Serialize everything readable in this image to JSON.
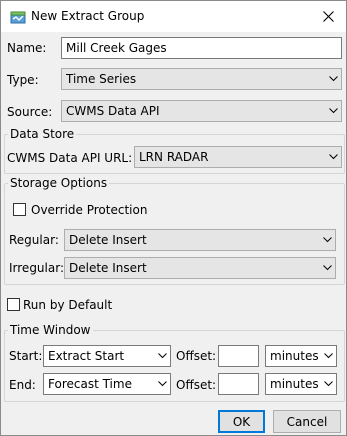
{
  "window": {
    "title": "New Extract Group",
    "close_icon": "close-icon",
    "app_icon": "extract-group-icon"
  },
  "name": {
    "label": "Name:",
    "value": "Mill Creek Gages"
  },
  "type": {
    "label": "Type:",
    "value": "Time Series"
  },
  "source": {
    "label": "Source:",
    "value": "CWMS Data API"
  },
  "data_store": {
    "title": "Data Store",
    "url_label": "CWMS Data API URL:",
    "url_value": "LRN RADAR"
  },
  "storage": {
    "title": "Storage Options",
    "override_label": "Override Protection",
    "override_checked": false,
    "regular_label": "Regular:",
    "regular_value": "Delete Insert",
    "irregular_label": "Irregular:",
    "irregular_value": "Delete Insert"
  },
  "run_by_default": {
    "label": "Run by Default",
    "checked": false
  },
  "time_window": {
    "title": "Time Window",
    "start_label": "Start:",
    "start_value": "Extract Start",
    "end_label": "End:",
    "end_value": "Forecast Time",
    "offset_label": "Offset:",
    "start_offset": "",
    "end_offset": "",
    "start_units": "minutes",
    "end_units": "minutes"
  },
  "buttons": {
    "ok": "OK",
    "cancel": "Cancel"
  }
}
